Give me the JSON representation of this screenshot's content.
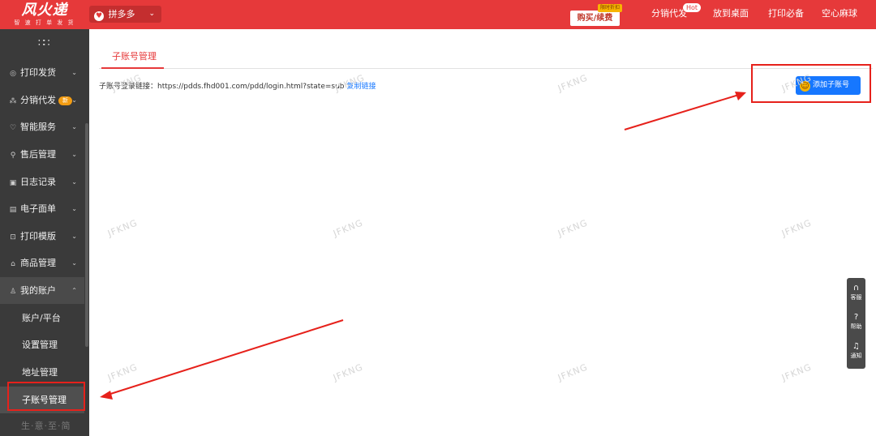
{
  "header": {
    "logo": {
      "name": "风火递",
      "tagline": "智 速 打 单 发 货"
    },
    "platform": {
      "icon": "pinduoduo-icon",
      "label": "拼多多"
    },
    "buy": {
      "tag": "限时折扣",
      "label": "购买/续费"
    },
    "links": [
      {
        "label": "分销代发",
        "badge": "Hot"
      },
      {
        "label": "放到桌面"
      },
      {
        "label": "打印必备"
      },
      {
        "label": "空心麻球"
      }
    ],
    "bg_color": "#e6393a"
  },
  "sidebar": {
    "grid_icon": "grid-icon",
    "menu": [
      {
        "icon": "print-icon",
        "label": "打印发货"
      },
      {
        "icon": "share-icon",
        "label": "分销代发",
        "badge": "新"
      },
      {
        "icon": "service-icon",
        "label": "智能服务"
      },
      {
        "icon": "after-sale-icon",
        "label": "售后管理"
      },
      {
        "icon": "log-icon",
        "label": "日志记录"
      },
      {
        "icon": "waybill-icon",
        "label": "电子面单"
      },
      {
        "icon": "template-icon",
        "label": "打印模版"
      },
      {
        "icon": "goods-icon",
        "label": "商品管理"
      },
      {
        "icon": "user-icon",
        "label": "我的账户"
      }
    ],
    "submenu": [
      {
        "label": "账户/平台"
      },
      {
        "label": "设置管理"
      },
      {
        "label": "地址管理"
      },
      {
        "label": "子账号管理"
      }
    ],
    "brand": "生·意·至·简",
    "bg_color": "#3a3a3a"
  },
  "main": {
    "tab": "子账号管理",
    "login_label": "子账号登录链接：",
    "login_url": "https://pdds.fhd001.com/pdd/login.html?state=sub",
    "copy_link": "复制链接",
    "add_button": "添加子账号",
    "watermark": "JFKNG",
    "accent_color": "#1677ff"
  },
  "float_panel": [
    {
      "icon": "headset-icon",
      "label": "客服"
    },
    {
      "icon": "help-icon",
      "label": "帮助"
    },
    {
      "icon": "bell-icon",
      "label": "通知"
    }
  ]
}
